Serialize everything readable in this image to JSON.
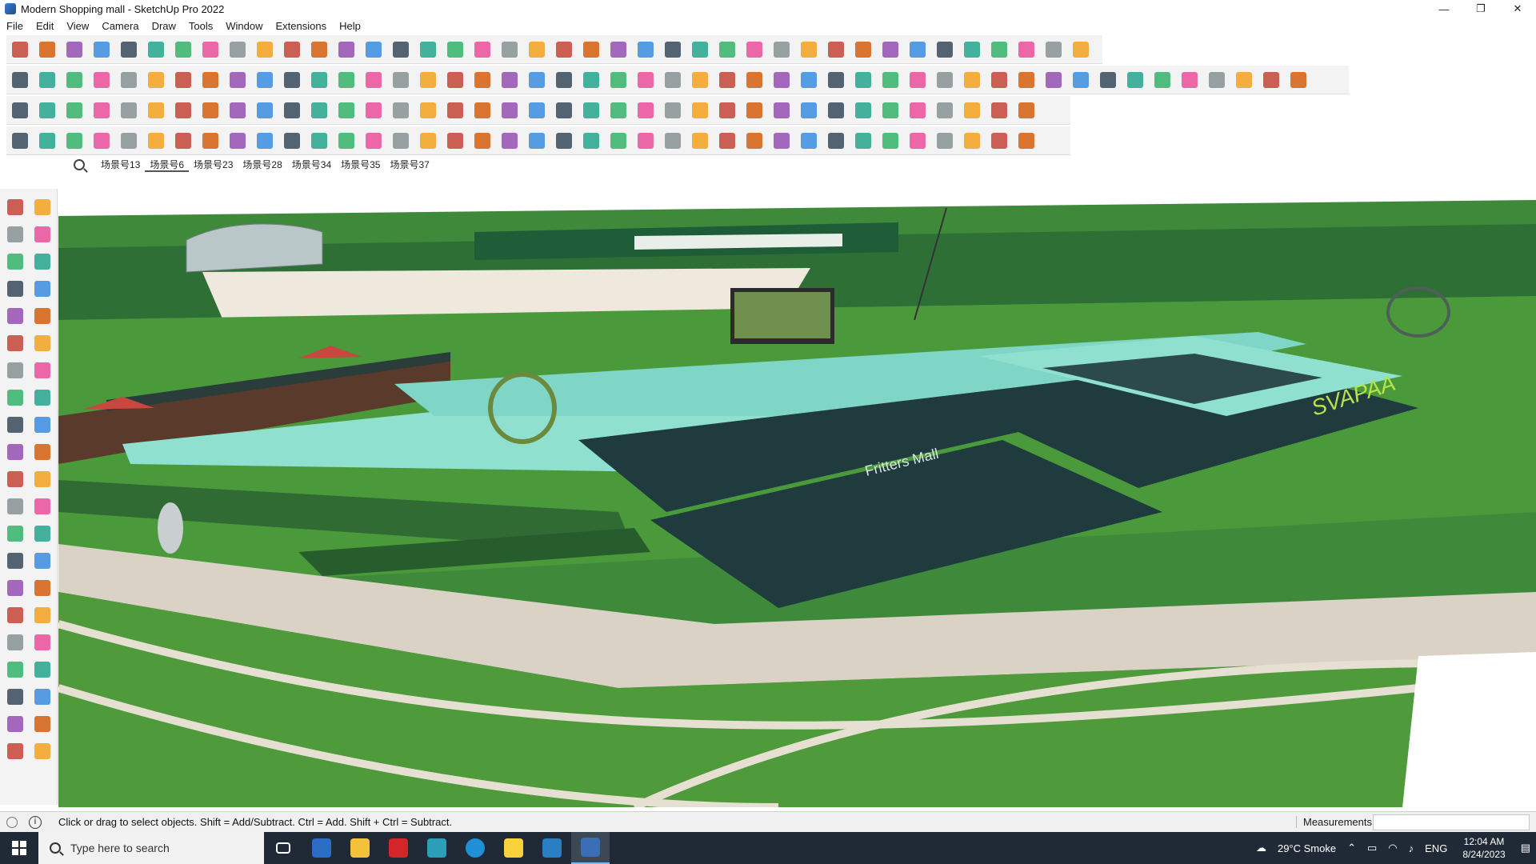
{
  "window": {
    "title": "Modern Shopping mall - SketchUp Pro 2022",
    "controls": [
      "—",
      "❐",
      "✕"
    ]
  },
  "menu": [
    "File",
    "Edit",
    "View",
    "Camera",
    "Draw",
    "Tools",
    "Window",
    "Extensions",
    "Help"
  ],
  "scenes": {
    "tabs": [
      "场景号13",
      "场景号6",
      "场景号23",
      "场景号28",
      "场景号34",
      "场景号35",
      "场景号37"
    ],
    "active": "场景号6"
  },
  "viewport": {
    "screen_text": "Fritters Mall",
    "sign_text": "SVAPAA"
  },
  "status": {
    "hint": "Click or drag to select objects. Shift = Add/Subtract. Ctrl = Add. Shift + Ctrl = Subtract.",
    "measurements_label": "Measurements",
    "measurements_value": ""
  },
  "taskbar": {
    "search_placeholder": "Type here to search",
    "weather": "29°C  Smoke",
    "language": "ENG",
    "time": "12:04 AM",
    "date": "8/24/2023"
  },
  "colors": {
    "grass": "#4f9a3a",
    "dark_grass": "#2f6b33",
    "water": "#8fe0cf",
    "plaza": "#1f3b3d",
    "path": "#d9d2c5",
    "taskbar": "#1f2a36"
  }
}
